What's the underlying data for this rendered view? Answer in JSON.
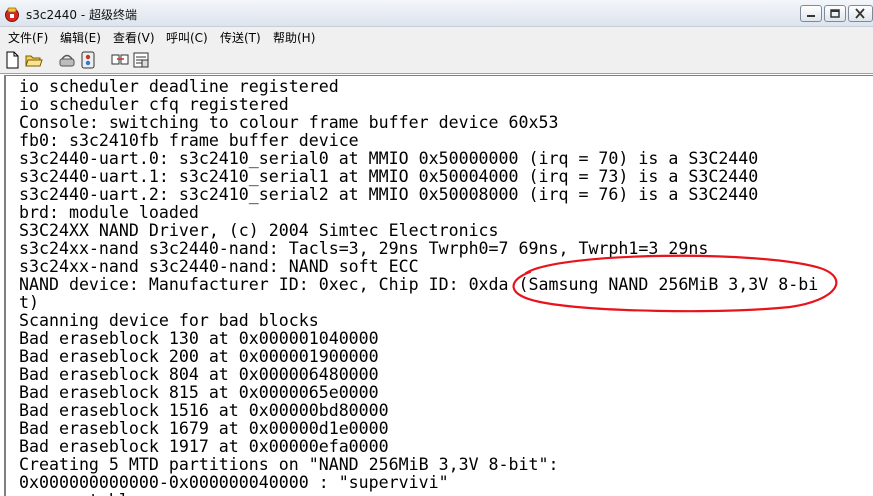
{
  "window": {
    "title": "s3c2440 - 超级终端"
  },
  "menu": {
    "items": [
      {
        "label": "文件(F)"
      },
      {
        "label": "编辑(E)"
      },
      {
        "label": "查看(V)"
      },
      {
        "label": "呼叫(C)"
      },
      {
        "label": "传送(T)"
      },
      {
        "label": "帮助(H)"
      }
    ]
  },
  "toolbar": {
    "icons": [
      "new-document-icon",
      "open-folder-icon",
      "disconnect-icon",
      "phone-dial-icon",
      "send-file-icon",
      "properties-icon"
    ]
  },
  "terminal": {
    "lines": [
      "io scheduler deadline registered",
      "io scheduler cfq registered",
      "Console: switching to colour frame buffer device 60x53",
      "fb0: s3c2410fb frame buffer device",
      "s3c2440-uart.0: s3c2410_serial0 at MMIO 0x50000000 (irq = 70) is a S3C2440",
      "s3c2440-uart.1: s3c2410_serial1 at MMIO 0x50004000 (irq = 73) is a S3C2440",
      "s3c2440-uart.2: s3c2410_serial2 at MMIO 0x50008000 (irq = 76) is a S3C2440",
      "brd: module loaded",
      "S3C24XX NAND Driver, (c) 2004 Simtec Electronics",
      "s3c24xx-nand s3c2440-nand: Tacls=3, 29ns Twrph0=7 69ns, Twrph1=3 29ns",
      "s3c24xx-nand s3c2440-nand: NAND soft ECC",
      "NAND device: Manufacturer ID: 0xec, Chip ID: 0xda (Samsung NAND 256MiB 3,3V 8-bi",
      "t)",
      "Scanning device for bad blocks",
      "Bad eraseblock 130 at 0x000001040000",
      "Bad eraseblock 200 at 0x000001900000",
      "Bad eraseblock 804 at 0x000006480000",
      "Bad eraseblock 815 at 0x0000065e0000",
      "Bad eraseblock 1516 at 0x00000bd80000",
      "Bad eraseblock 1679 at 0x00000d1e0000",
      "Bad eraseblock 1917 at 0x00000efa0000",
      "Creating 5 MTD partitions on \"NAND 256MiB 3,3V 8-bit\":",
      "0x000000000000-0x000000040000 : \"supervivi\"",
      "      ptable"
    ],
    "annotation_color": "#e8141c"
  }
}
